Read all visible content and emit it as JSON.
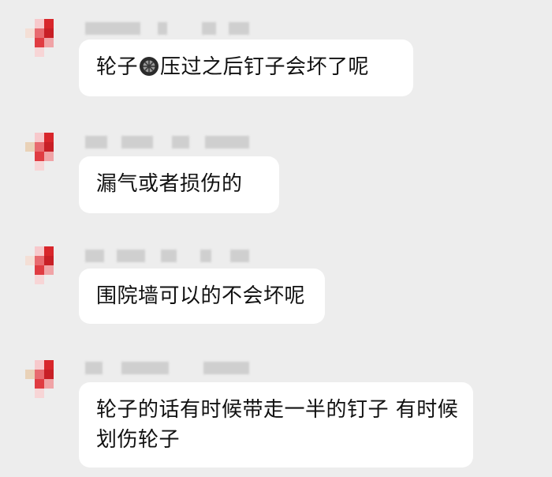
{
  "conversation": {
    "messages": [
      {
        "sender_name": "",
        "text_before_icon": "轮子",
        "icon": "wheel-icon",
        "text_after_icon": "压过之后钉子会坏了呢"
      },
      {
        "sender_name": "",
        "text": "漏气或者损伤的"
      },
      {
        "sender_name": "",
        "text": "围院墙可以的不会坏呢"
      },
      {
        "sender_name": "",
        "text": "轮子的话有时候带走一半的钉子 有时候划伤轮子"
      }
    ]
  },
  "colors": {
    "background": "#ededed",
    "bubble": "#ffffff",
    "text": "#111111",
    "avatar_red": "#d8262b",
    "avatar_pink": "#f2b8bb",
    "avatar_beige": "#e9d2b8",
    "blur_gray": "#cfcfcf"
  }
}
